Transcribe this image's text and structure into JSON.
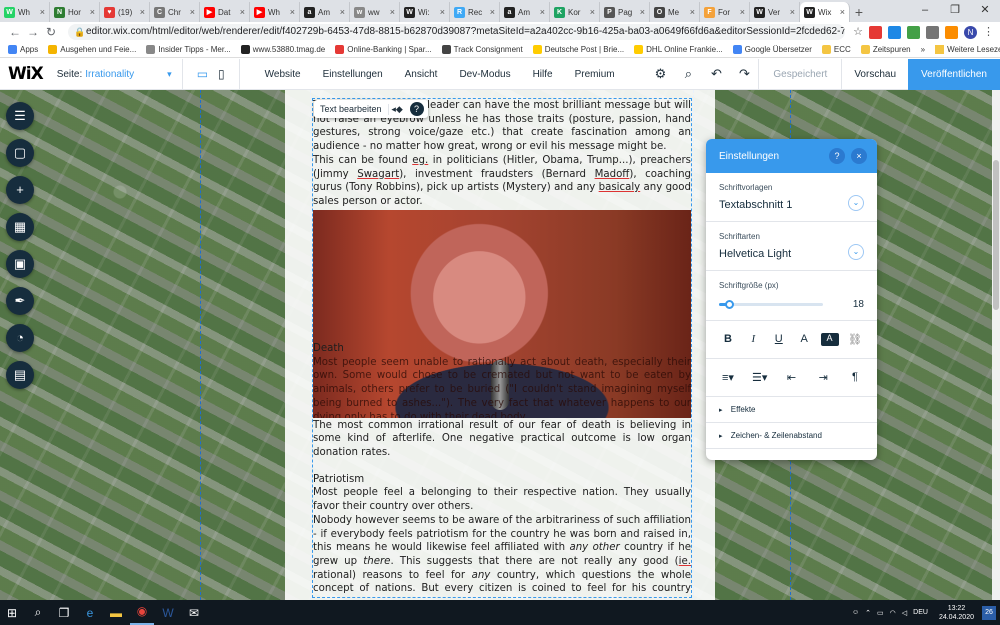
{
  "browser": {
    "tabs": [
      {
        "label": "Wh",
        "icon_color": "#25d366",
        "icon": "W"
      },
      {
        "label": "Hor",
        "icon_color": "#2e7d32",
        "icon": "N"
      },
      {
        "label": "(19)",
        "icon_color": "#e53935",
        "icon": "♥"
      },
      {
        "label": "Chr",
        "icon_color": "#777777",
        "icon": "C"
      },
      {
        "label": "Dat",
        "icon_color": "#ff0000",
        "icon": "▶"
      },
      {
        "label": "Wh",
        "icon_color": "#ff0000",
        "icon": "▶"
      },
      {
        "label": "Am",
        "icon_color": "#222222",
        "icon": "a"
      },
      {
        "label": "ww",
        "icon_color": "#888888",
        "icon": "w"
      },
      {
        "label": "Wi:",
        "icon_color": "#222222",
        "icon": "W"
      },
      {
        "label": "Rec",
        "icon_color": "#3fa9f5",
        "icon": "R"
      },
      {
        "label": "Am",
        "icon_color": "#222222",
        "icon": "a"
      },
      {
        "label": "Kor",
        "icon_color": "#1ea362",
        "icon": "K"
      },
      {
        "label": "Pag",
        "icon_color": "#555555",
        "icon": "P"
      },
      {
        "label": "Me",
        "icon_color": "#444444",
        "icon": "O"
      },
      {
        "label": "For",
        "icon_color": "#f4a23b",
        "icon": "F"
      },
      {
        "label": "Ver",
        "icon_color": "#222222",
        "icon": "W"
      },
      {
        "label": "Wix",
        "icon_color": "#222222",
        "icon": "W",
        "active": true
      }
    ],
    "new_tab": "+",
    "url": "editor.wix.com/html/editor/web/renderer/edit/f402729b-6453-47d8-8815-b62870d39087?metaSiteId=a2a402cc-9b16-425a-ba03-a0649f66fd6a&editorSessionId=2fcded62-76ef-4a02-99e1-127b39af1...",
    "profile_initial": "N",
    "bookmarks": [
      {
        "label": "Apps",
        "color": "#4285f4"
      },
      {
        "label": "Ausgehen und Feie...",
        "color": "#f4b400"
      },
      {
        "label": "Insider Tipps - Mer...",
        "color": "#888888"
      },
      {
        "label": "www.53880.tmag.de",
        "color": "#222222"
      },
      {
        "label": "Online-Banking | Spar...",
        "color": "#e53935"
      },
      {
        "label": "Track Consignment",
        "color": "#444444"
      },
      {
        "label": "Deutsche Post | Brie...",
        "color": "#ffcc00"
      },
      {
        "label": "DHL Online Frankie...",
        "color": "#ffcc00"
      },
      {
        "label": "Google Übersetzer",
        "color": "#4285f4"
      },
      {
        "label": "ECC",
        "color": "#f4c542"
      },
      {
        "label": "Zeitspuren",
        "color": "#f4c542"
      }
    ],
    "bookmarks_more": "»",
    "bookmarks_other": "Weitere Lesezeichen"
  },
  "wix": {
    "logo": "WiX",
    "page_prefix": "Seite:",
    "page_name": "Irrationality",
    "menu": [
      "Website",
      "Einstellungen",
      "Ansicht",
      "Dev-Modus",
      "Hilfe",
      "Premium"
    ],
    "saved": "Gespeichert",
    "preview": "Vorschau",
    "publish": "Veröffentlichen"
  },
  "editor": {
    "chip_label": "Text bearbeiten",
    "paragraphs_top": [
      "The most charismatic leader can have the most brilliant message but will not raise an eyebrow unless he has those traits (posture, passion, hand gestures, strong voice/gaze etc.) that create fascination among an audience - no matter how great, wrong or evil his message might be.",
      "This can be found eg. in politicians (Hitler, Obama, Trump...), preachers (Jimmy Swagart), investment fraudsters (Bernard Madoff), coaching gurus (Tony Robbins), pick up artists (Mystery) and any basicaly any good sales person or actor."
    ],
    "death_heading": "Death",
    "death_text": "Most people seem unable to rationally act about death, especially their own. Some would chose to be cremated but not want to be eaten by animals, others prefer to be buried (\"I couldn't stand imagining myself being burned to ashes...\"). The very fact that whatever happens to our dying only has to do with their dead body.",
    "death_text2": "The most common irrational result of our fear of death is believing in some kind of afterlife. One negative practical outcome is low organ donation rates.",
    "patriotism_heading": "Patriotism",
    "patriotism_p1": "Most people feel a belonging to their respective nation. They usually favor their country over others.",
    "patriotism_p2": "Nobody however seems to be aware of the arbitrariness of such affiliation - if everybody feels patriotism for the country he was born and raised in, this means he would likewise feel affiliated with any other country if he grew up there. This suggests that there are not really any good (ie. rational) reasons to feel for any country, which questions the whole concept of nations. But every citizen is coined to feel for his country since childhood, so patriotism just feels naturally right. This likewise goes for religious, political or other beliefs."
  },
  "settings_panel": {
    "title": "Einstellungen",
    "help": "?",
    "close": "×",
    "font_preset_label": "Schriftvorlagen",
    "font_preset_value": "Textabschnitt 1",
    "font_family_label": "Schriftarten",
    "font_family_value": "Helvetica Light",
    "font_size_label": "Schriftgröße (px)",
    "font_size_value": "18",
    "font_size_fraction": 0.1,
    "sections": [
      "Effekte",
      "Zeichen- & Zeilenabstand"
    ]
  },
  "taskbar": {
    "lang": "DEU",
    "time": "13:22",
    "date": "24.04.2020",
    "notifications": "26"
  },
  "colors": {
    "wix_blue": "#3899ec",
    "wix_dark": "#162d3d",
    "taskbar": "#101820"
  }
}
